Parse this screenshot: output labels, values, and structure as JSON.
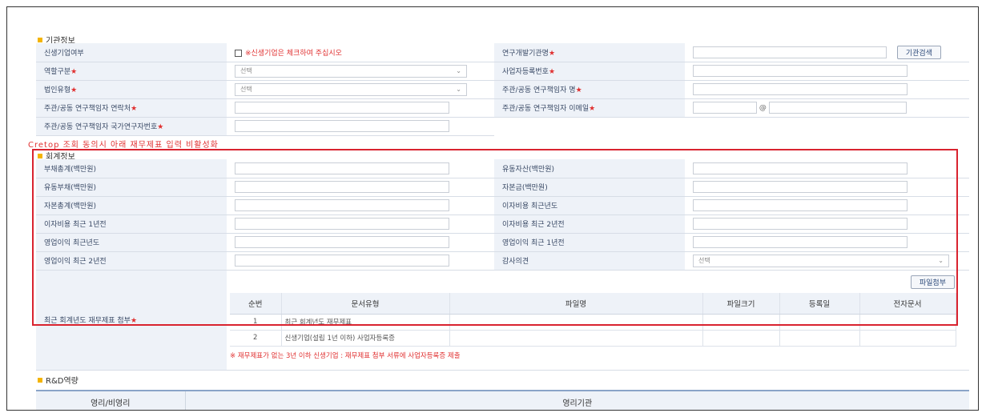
{
  "top_clipped_text": "· · ·",
  "agency_section": {
    "title": "기관정보",
    "rows": [
      {
        "label": "신생기업여부",
        "required": false,
        "checkbox_text": "※신생기업은 체크하여 주십시오",
        "right_label": "연구개발기관명",
        "right_required": true,
        "search_button": "기관검색"
      },
      {
        "label": "역할구분",
        "required": true,
        "select_value": "선택",
        "right_label": "사업자등록번호",
        "right_required": true
      },
      {
        "label": "법인유형",
        "required": true,
        "select_value": "선택",
        "right_label": "주관/공동 연구책임자 명",
        "right_required": true
      },
      {
        "label": "주관/공동 연구책임자 연락처",
        "required": true,
        "right_label": "주관/공동 연구책임자 이메일",
        "right_required": true,
        "email_at": "@"
      },
      {
        "label": "주관/공동 연구책임자 국가연구자번호",
        "required": true
      }
    ]
  },
  "cretop_note": "Cretop 조회 동의시 아래 재무제표 입력 비활성화",
  "accounting_section": {
    "title": "회계정보",
    "rows": [
      {
        "left": "부채총계(백만원)",
        "right": "유동자산(백만원)"
      },
      {
        "left": "유동부채(백만원)",
        "right": "자본금(백만원)"
      },
      {
        "left": "자본총계(백만원)",
        "right": "이자비용 최근년도"
      },
      {
        "left": "이자비용 최근 1년전",
        "right": "이자비용 최근 2년전"
      },
      {
        "left": "영업이익 최근년도",
        "right": "영업이익 최근 1년전"
      },
      {
        "left": "영업이익 최근 2년전",
        "right": "감사의견",
        "right_select": "선택"
      }
    ],
    "attach": {
      "label": "최근 회계년도 재무제표 첨부",
      "required": true,
      "button": "파일첨부",
      "columns": [
        "순번",
        "문서유형",
        "파일명",
        "파일크기",
        "등록일",
        "전자문서"
      ],
      "rows": [
        {
          "no": "1",
          "type": "최근 회계년도 재무제표"
        },
        {
          "no": "2",
          "type": "신생기업(설립 1년 이하) 사업자등록증"
        }
      ],
      "note": "※ 재무제표가 없는 3년 이하 신생기업 : 재무제표 첨부 서류에 사업자등록증 제출"
    }
  },
  "rd_section": {
    "title": "R&D역량",
    "col1": "영리/비영리",
    "col2": "영리기관"
  },
  "required_mark": "★",
  "colors": {
    "required": "#e03030",
    "label_bg": "#eef2f8",
    "highlight_box": "#d9232f",
    "section_icon": "#f4b400"
  }
}
